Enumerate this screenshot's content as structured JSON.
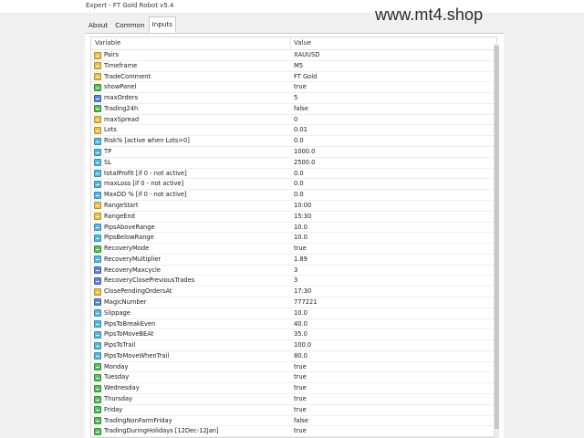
{
  "window": {
    "title": "Expert - FT Gold Robot v5.4"
  },
  "watermark": "www.mt4.shop",
  "tabs": [
    {
      "label": "About"
    },
    {
      "label": "Common"
    },
    {
      "label": "Inputs",
      "active": true
    }
  ],
  "grid": {
    "col_variable": "Variable",
    "col_value": "Value",
    "rows": [
      {
        "name": "Pairs",
        "value": "XAUUSD",
        "icon": "string-type-icon"
      },
      {
        "name": "Timeframe",
        "value": "M5",
        "icon": "string-type-icon"
      },
      {
        "name": "TradeComment",
        "value": "FT Gold",
        "icon": "string-type-icon"
      },
      {
        "name": "showPanel",
        "value": "true",
        "icon": "bool-type-icon"
      },
      {
        "name": "maxOrders",
        "value": "5",
        "icon": "int-type-icon"
      },
      {
        "name": "Trading24h",
        "value": "false",
        "icon": "bool-type-icon"
      },
      {
        "name": "maxSpread",
        "value": "0",
        "icon": "string-type-icon"
      },
      {
        "name": "Lots",
        "value": "0.01",
        "icon": "string-type-icon"
      },
      {
        "name": "Risk% [active when Lots=0]",
        "value": "0.0",
        "icon": "double-type-icon"
      },
      {
        "name": "TP",
        "value": "1000.0",
        "icon": "double-type-icon"
      },
      {
        "name": "SL",
        "value": "2500.0",
        "icon": "double-type-icon"
      },
      {
        "name": "totalProfit [if 0 - not active]",
        "value": "0.0",
        "icon": "double-type-icon"
      },
      {
        "name": "maxLoss [if 0 - not active]",
        "value": "0.0",
        "icon": "double-type-icon"
      },
      {
        "name": "MaxDD % [if 0 - not active]",
        "value": "0.0",
        "icon": "double-type-icon"
      },
      {
        "name": "RangeStart",
        "value": "10:00",
        "icon": "string-type-icon"
      },
      {
        "name": "RangeEnd",
        "value": "15:30",
        "icon": "string-type-icon"
      },
      {
        "name": "PipsAboveRange",
        "value": "10.0",
        "icon": "double-type-icon"
      },
      {
        "name": "PipsBelowRange",
        "value": "10.0",
        "icon": "double-type-icon"
      },
      {
        "name": "RecoveryMode",
        "value": "true",
        "icon": "bool-type-icon"
      },
      {
        "name": "RecoveryMultiplier",
        "value": "1.89",
        "icon": "double-type-icon"
      },
      {
        "name": "RecoveryMaxcycle",
        "value": "3",
        "icon": "int-type-icon"
      },
      {
        "name": "RecoveryClosePreviousTrades",
        "value": "3",
        "icon": "int-type-icon"
      },
      {
        "name": "ClosePendingOrdersAt",
        "value": "17:30",
        "icon": "string-type-icon"
      },
      {
        "name": "MagicNumber",
        "value": "777221",
        "icon": "int-type-icon"
      },
      {
        "name": "Slippage",
        "value": "10.0",
        "icon": "double-type-icon"
      },
      {
        "name": "PipsToBreakEven",
        "value": "40.0",
        "icon": "double-type-icon"
      },
      {
        "name": "PipsToMoveBEAt",
        "value": "35.0",
        "icon": "double-type-icon"
      },
      {
        "name": "PipsToTrail",
        "value": "100.0",
        "icon": "double-type-icon"
      },
      {
        "name": "PipsToMoveWhenTrail",
        "value": "80.0",
        "icon": "double-type-icon"
      },
      {
        "name": "Monday",
        "value": "true",
        "icon": "bool-type-icon"
      },
      {
        "name": "Tuesday",
        "value": "true",
        "icon": "bool-type-icon"
      },
      {
        "name": "Wednesday",
        "value": "true",
        "icon": "bool-type-icon"
      },
      {
        "name": "Thursday",
        "value": "true",
        "icon": "bool-type-icon"
      },
      {
        "name": "Friday",
        "value": "true",
        "icon": "bool-type-icon"
      },
      {
        "name": "TradingNonFarmFriday",
        "value": "false",
        "icon": "bool-type-icon"
      },
      {
        "name": "TradingDuringHolidays [12Dec-12Jan]",
        "value": "true",
        "icon": "bool-type-icon"
      }
    ]
  }
}
